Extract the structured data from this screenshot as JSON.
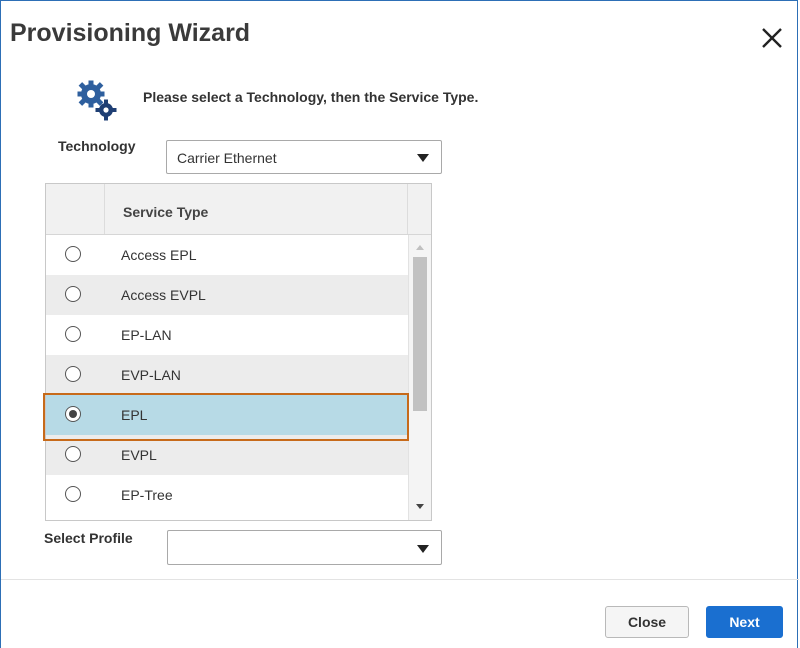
{
  "dialog": {
    "title": "Provisioning Wizard",
    "close_icon": "close-icon"
  },
  "instruction": {
    "icon": "gears-icon",
    "text": "Please select a Technology, then the Service Type."
  },
  "technology": {
    "label": "Technology",
    "value": "Carrier Ethernet"
  },
  "service_grid": {
    "header": "Service Type",
    "rows": [
      {
        "label": "Access EPL",
        "selected": false
      },
      {
        "label": "Access EVPL",
        "selected": false
      },
      {
        "label": "EP-LAN",
        "selected": false
      },
      {
        "label": "EVP-LAN",
        "selected": false
      },
      {
        "label": "EPL",
        "selected": true
      },
      {
        "label": "EVPL",
        "selected": false
      },
      {
        "label": "EP-Tree",
        "selected": false
      }
    ]
  },
  "profile": {
    "label": "Select Profile",
    "value": ""
  },
  "footer": {
    "close_label": "Close",
    "next_label": "Next"
  },
  "colors": {
    "accent": "#1a6fd0",
    "selected_row": "#b7dae6",
    "highlight_border": "#c76a1a"
  }
}
